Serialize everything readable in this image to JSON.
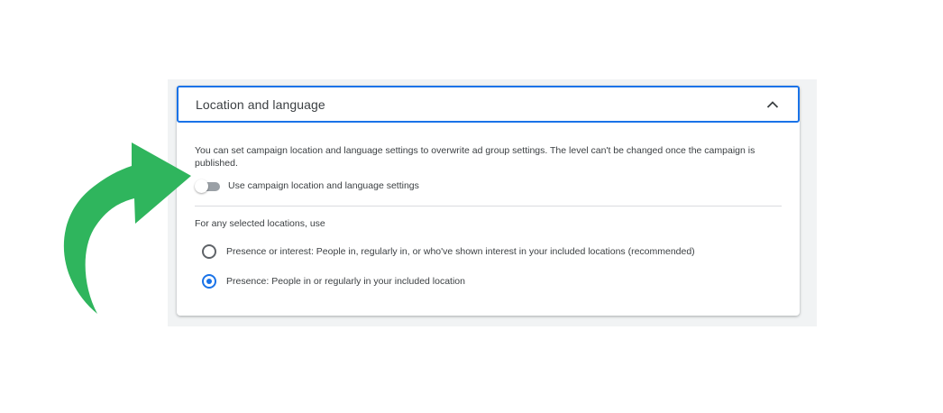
{
  "panel": {
    "title": "Location and language",
    "description": "You can set campaign location and language settings to overwrite ad group settings. The level can't be changed once the campaign is published.",
    "toggle_label": "Use campaign location and language settings",
    "toggle_on": false,
    "section_label": "For any selected locations, use",
    "options": [
      {
        "label": "Presence or interest: People in, regularly in, or who've shown interest in your included locations (recommended)",
        "selected": false
      },
      {
        "label": "Presence: People in or regularly in your included location",
        "selected": true
      }
    ]
  },
  "colors": {
    "accent": "#1a73e8",
    "arrow": "#2fb55d",
    "text": "#3c4043"
  },
  "icons": {
    "collapse": "chevron-up-icon",
    "annotation": "curved-arrow-icon"
  }
}
